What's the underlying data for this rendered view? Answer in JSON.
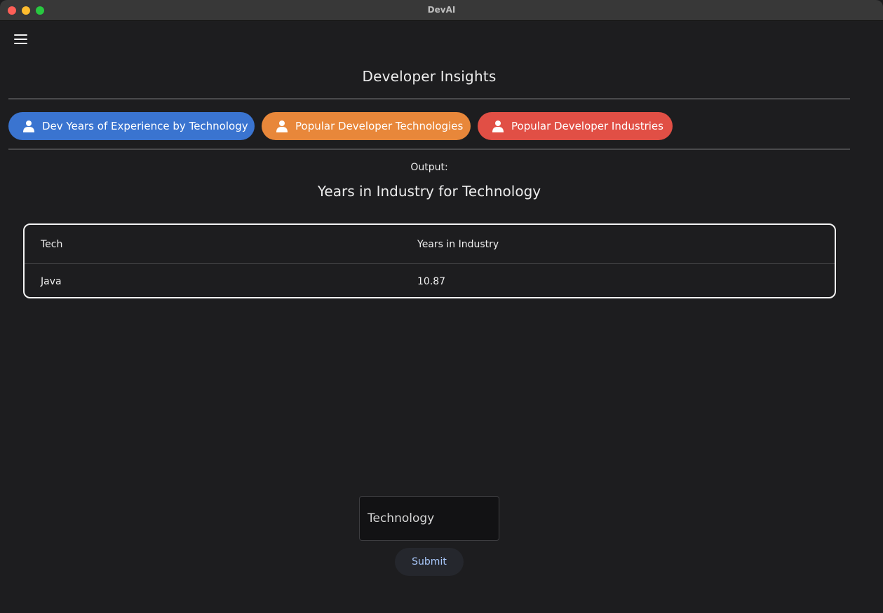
{
  "window": {
    "title": "DevAI"
  },
  "header": {
    "title": "Developer Insights"
  },
  "tabs": [
    {
      "label": "Dev Years of Experience by Technology",
      "icon": "person-icon",
      "color": "#3a74d0"
    },
    {
      "label": "Popular Developer Technologies",
      "icon": "person-icon",
      "color": "#e8873a"
    },
    {
      "label": "Popular Developer Industries",
      "icon": "person-icon",
      "color": "#e14f45"
    }
  ],
  "output": {
    "label": "Output:",
    "title": "Years in Industry for Technology",
    "table": {
      "columns": [
        "Tech",
        "Years in Industry"
      ],
      "rows": [
        [
          "Java",
          "10.87"
        ]
      ]
    }
  },
  "form": {
    "input_placeholder": "Technology",
    "submit_label": "Submit"
  }
}
